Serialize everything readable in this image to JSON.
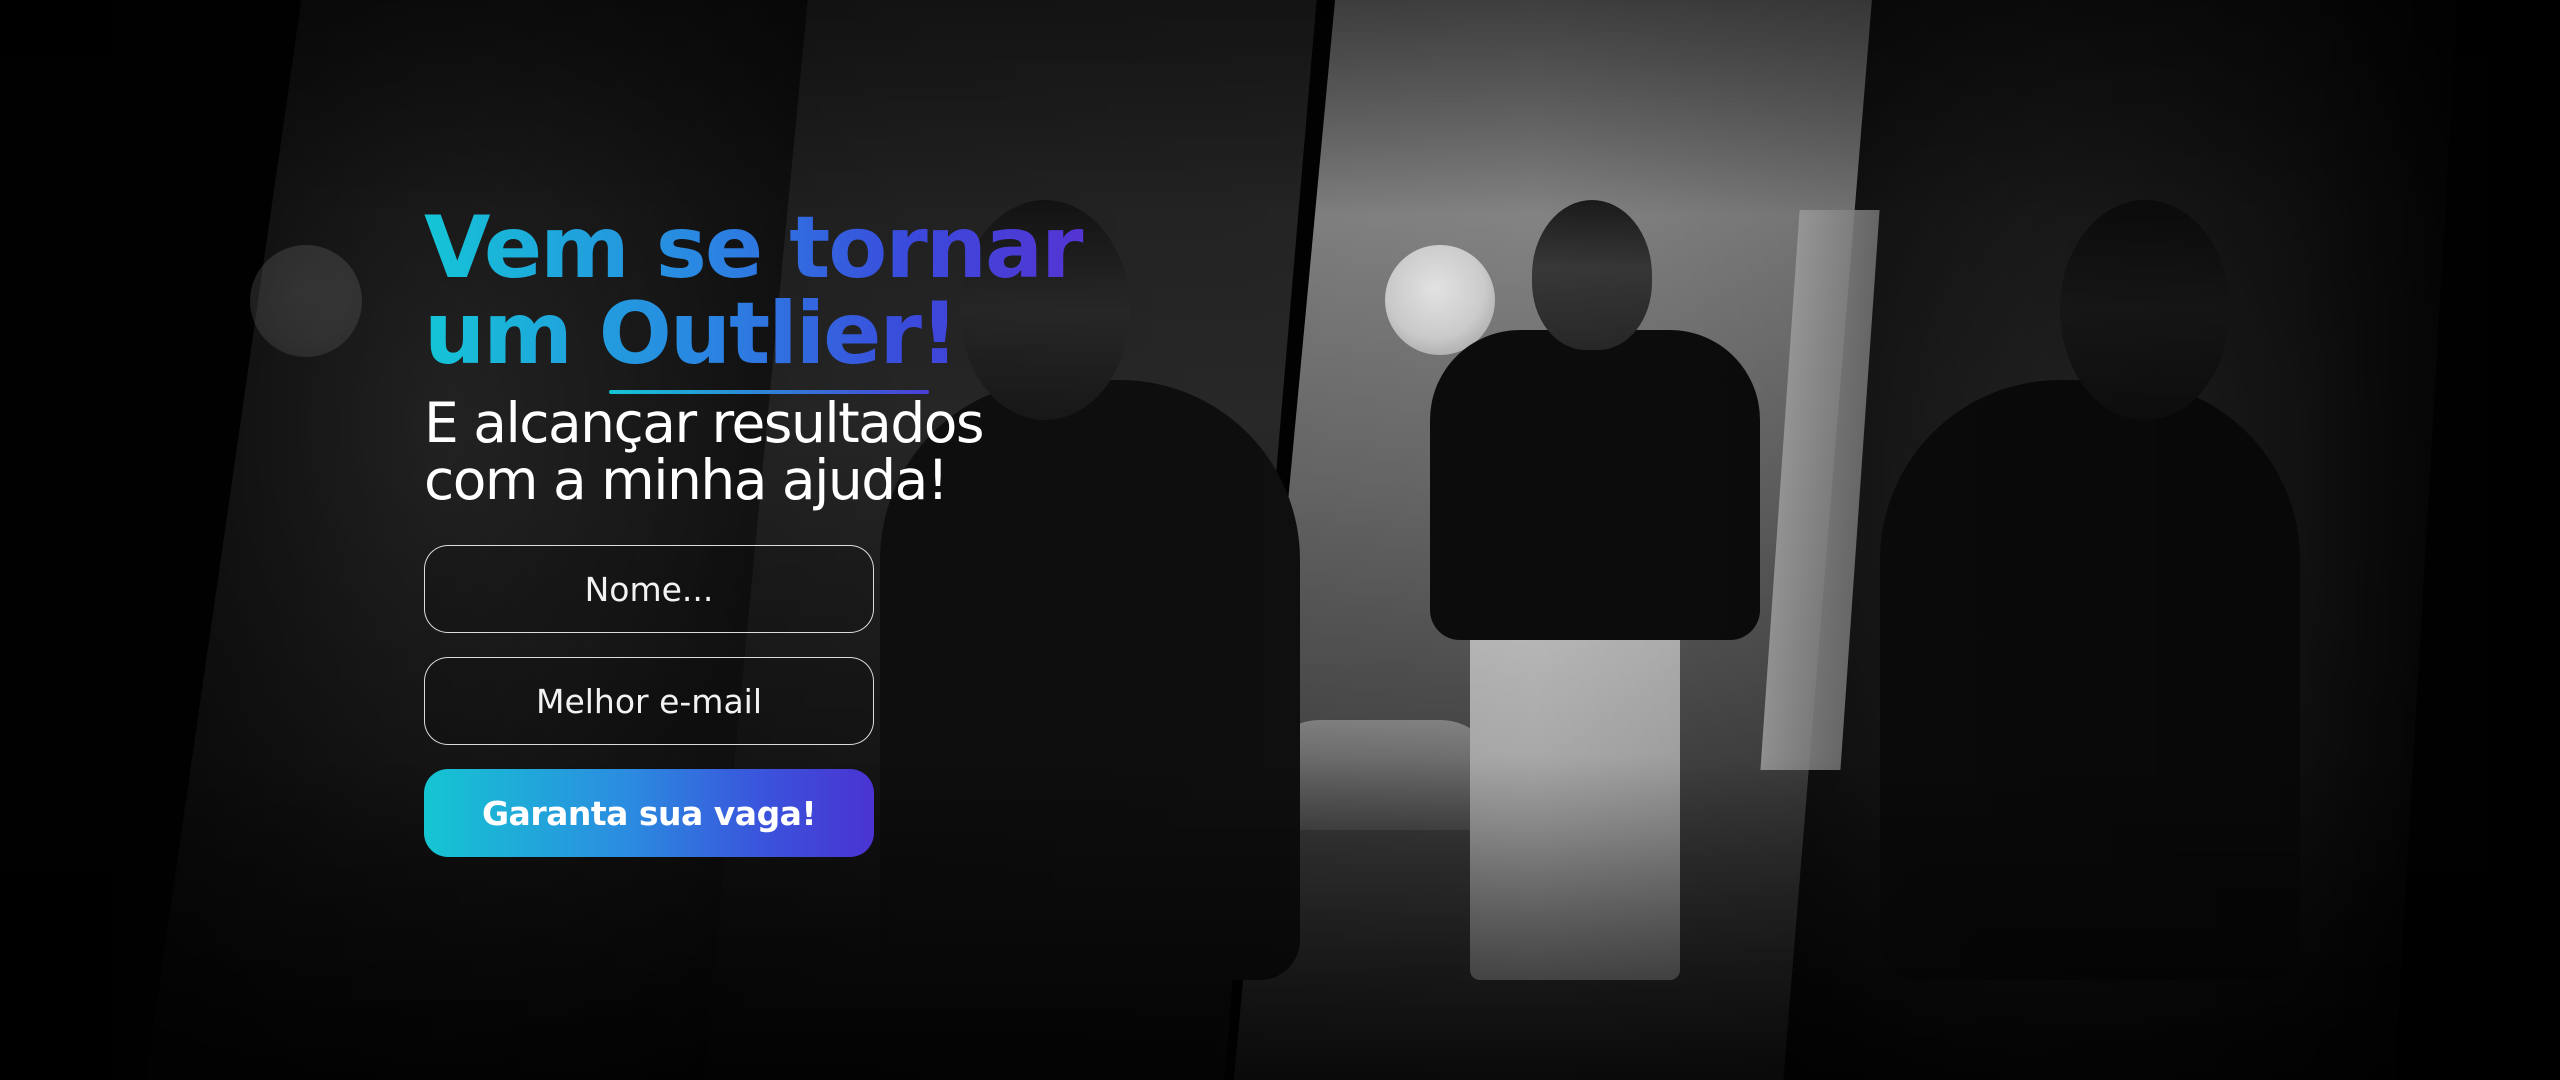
{
  "hero": {
    "headline_line1": "Vem se tornar",
    "headline_line2": "um Outlier!",
    "subhead_line1": "E alcançar resultados",
    "subhead_line2": "com a minha ajuda!"
  },
  "form": {
    "name_placeholder": "Nome...",
    "email_placeholder": "Melhor e-mail",
    "submit_label": "Garanta sua vaga!"
  },
  "colors": {
    "gradient_start": "#14c5d6",
    "gradient_mid": "#2a86e2",
    "gradient_end": "#5a2fd0",
    "text": "#ffffff",
    "background": "#000000"
  }
}
